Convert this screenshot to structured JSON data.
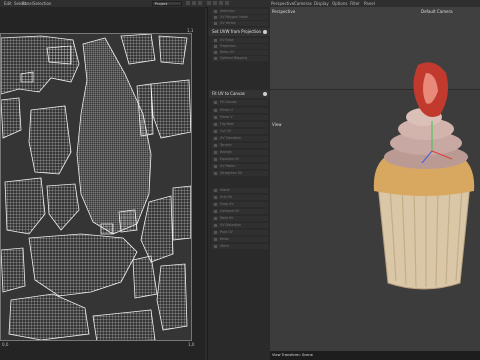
{
  "menubar": {
    "items": [
      "Edit",
      "Select",
      "Panel",
      "Selection"
    ],
    "projection_dropdown": "Project",
    "viewport_menu": [
      "Perspective",
      "Cameras",
      "Display",
      "Options",
      "Filter",
      "Panel"
    ]
  },
  "uv_editor": {
    "axis_top": "1,1",
    "axis_bottom": "0,0",
    "axis_bottom_right": "1,0"
  },
  "side_panel": {
    "sections": [
      {
        "label": "Set UVW from Projection",
        "rows": [
          "Selection",
          "UV Polygon Mode",
          "UV Vertex",
          "UV Edge",
          "Projection",
          "Relax UV",
          "Optimal Mapping"
        ]
      },
      {
        "label": "Fit UV to Canvas",
        "rows": [
          "Fit Canvas",
          "Mirror U",
          "Mirror V",
          "Flip Both",
          "Cut UV",
          "UV Transform",
          "Terrace",
          "Realign",
          "Equalize UV",
          "UV Peeler",
          "Straighten UV"
        ]
      },
      {
        "label": "",
        "rows": [
          "Island",
          "Grid UV",
          "Snap UV",
          "Collapse UV",
          "Weld UV",
          "UV Distortion",
          "Pack UV",
          "Relax",
          "Stitch"
        ]
      }
    ]
  },
  "viewport": {
    "camera_name": "Default Camera",
    "view_label": "Perspective",
    "mid_label": "View",
    "status_text": "View Transform: Scene"
  },
  "colors": {
    "uv_background": "#353535",
    "uv_wireframe": "#e8e8e8",
    "viewport_background": "#3c3c3c",
    "accent": "#cfcfcf"
  }
}
